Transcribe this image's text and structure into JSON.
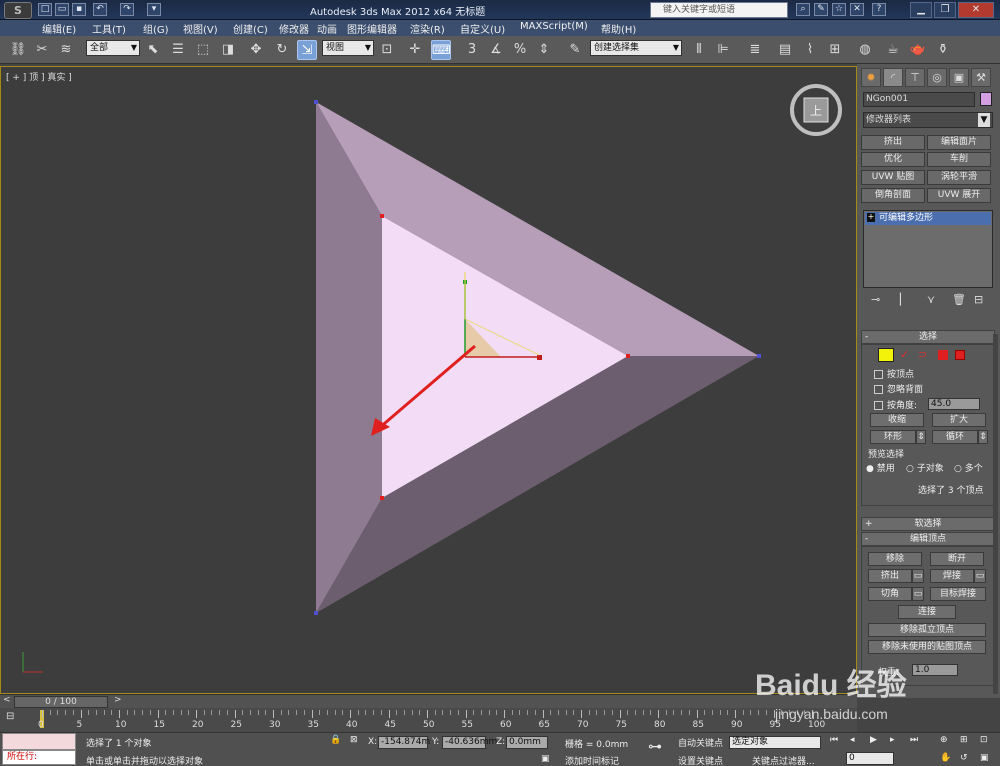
{
  "window": {
    "title": "Autodesk 3ds Max  2012 x64      无标题",
    "search_placeholder": "键入关键字或短语",
    "app_logo": "S"
  },
  "menu": [
    "编辑(E)",
    "工具(T)",
    "组(G)",
    "视图(V)",
    "创建(C)",
    "修改器",
    "动画",
    "图形编辑器",
    "渲染(R)",
    "自定义(U)",
    "MAXScript(M)",
    "帮助(H)"
  ],
  "toolbar": {
    "selection_filter": "全部",
    "reference_coord": "视图",
    "named_selection": "创建选择集"
  },
  "viewport": {
    "label": "[ + ] 顶 ] 真实 ]",
    "viewcube_face": "上"
  },
  "command_panel": {
    "object_name": "NGon001",
    "object_color": "#d49ee3",
    "modifier_list": "修改器列表",
    "modifier_buttons": [
      "挤出",
      "编辑面片",
      "优化",
      "车削",
      "UVW 贴图",
      "涡轮平滑",
      "倒角剖面",
      "UVW 展开"
    ],
    "stack_item": "可编辑多边形",
    "selection": {
      "title": "选择",
      "by_vertex": "按顶点",
      "ignore_backfacing": "忽略背面",
      "by_angle": "按角度:",
      "angle_value": "45.0",
      "shrink": "收缩",
      "grow": "扩大",
      "ring": "环形",
      "loop": "循环",
      "preview_title": "预览选择",
      "preview_off": "禁用",
      "preview_subobj": "子对象",
      "preview_multi": "多个",
      "status": "选择了 3 个顶点"
    },
    "soft_selection": "软选择",
    "edit_vertices": {
      "title": "编辑顶点",
      "remove": "移除",
      "break": "断开",
      "extrude": "挤出",
      "weld": "焊接",
      "chamfer": "切角",
      "target_weld": "目标焊接",
      "connect": "连接",
      "remove_isolated": "移除孤立顶点",
      "remove_unused_map": "移除未使用的贴图顶点",
      "weight_label": "权重:",
      "weight_value": "1.0"
    }
  },
  "timeline": {
    "frame_display": "0 / 100",
    "ticks": [
      "0",
      "5",
      "10",
      "15",
      "20",
      "25",
      "30",
      "35",
      "40",
      "45",
      "50",
      "55",
      "60",
      "65",
      "70",
      "75",
      "80",
      "85",
      "90",
      "95",
      "100"
    ]
  },
  "status": {
    "maxscript_label": "所在行:",
    "message1": "选择了 1 个对象",
    "message2": "单击或单击并拖动以选择对象",
    "x_label": "X:",
    "x_value": "-154.874m",
    "y_label": "Y:",
    "y_value": "-40.636mm",
    "z_label": "Z:",
    "z_value": "0.0mm",
    "grid": "栅格 = 0.0mm",
    "add_time_tag": "添加时间标记",
    "auto_key": "自动关键点",
    "set_key": "设置关键点",
    "selected_obj": "选定对象",
    "key_filters": "关键点过滤器...",
    "frame_value": "0"
  },
  "watermark": {
    "brand": "Baidu 经验",
    "url": "jingyan.baidu.com"
  }
}
